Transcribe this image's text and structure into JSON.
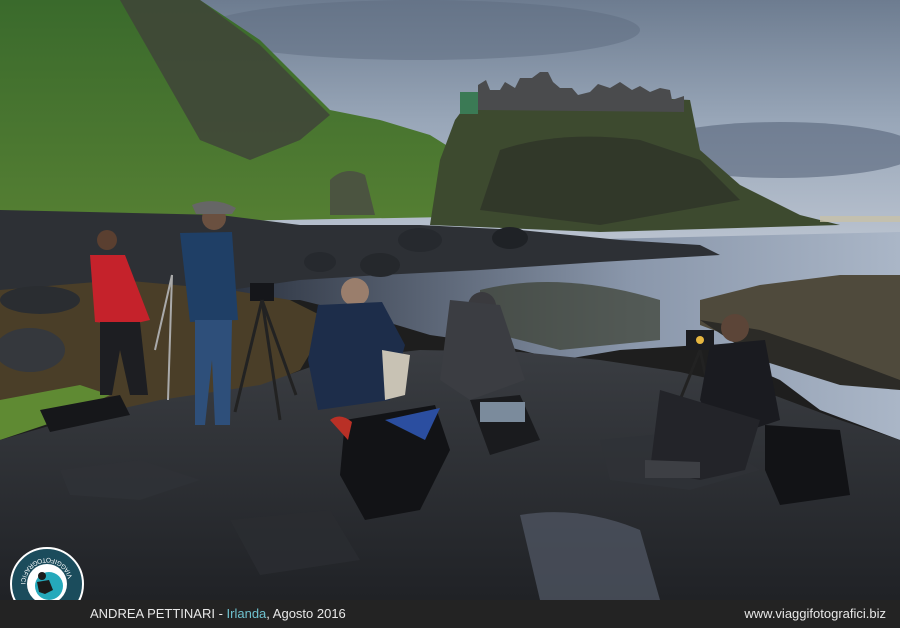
{
  "photo": {
    "scene": "photographers-on-rocky-shore-at-dusk"
  },
  "logo": {
    "ring_text": "VIAGGIFOTOGRAFICI.BIZ",
    "icon": "photographer-camera-logo-icon"
  },
  "caption": {
    "author": "ANDREA PETTINARI",
    "separator": " - ",
    "country": "Irlanda",
    "date_suffix": ", Agosto 2016",
    "website": "www.viaggifotografici.biz"
  },
  "colors": {
    "accent": "#6fc2cf",
    "footer_bg": "#232323"
  }
}
